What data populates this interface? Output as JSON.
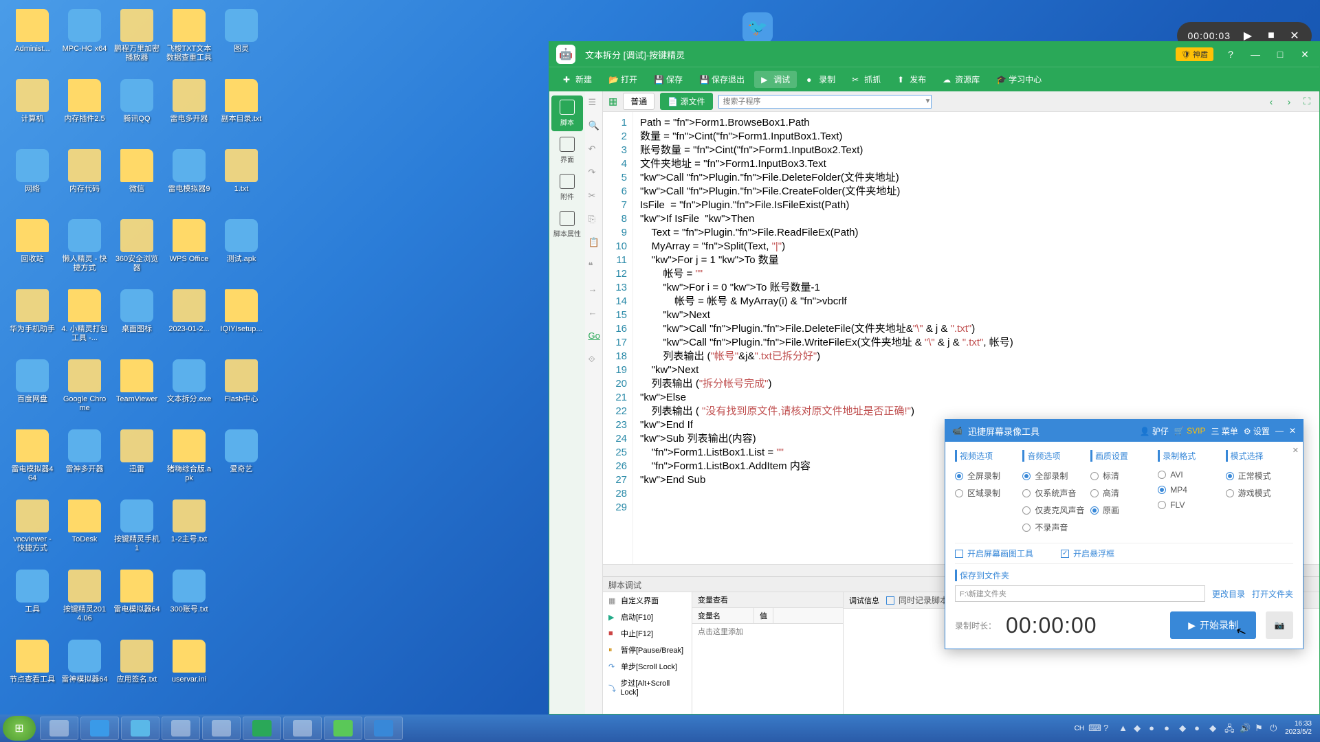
{
  "desktop": {
    "icons": [
      "Administ...",
      "MPC-HC x64",
      "鹏程万里加密播放器",
      "飞梭TXT文本数据查重工具",
      "图灵",
      "计算机",
      "内存插件2.5",
      "腾讯QQ",
      "雷电多开器",
      "副本目录.txt",
      "网络",
      "内存代码",
      "微信",
      "雷电模拟器9",
      "1.txt",
      "回收站",
      "懒人精灵 - 快捷方式",
      "360安全浏览器",
      "WPS Office",
      "测试.apk",
      "华为手机助手",
      "4. 小精灵打包工具 -...",
      "桌面图标",
      "2023-01-2...",
      "IQIYIsetup...",
      "百度网盘",
      "Google Chrome",
      "TeamViewer",
      "文本拆分.exe",
      "Flash中心",
      "雷电模拟器4 64",
      "雷神多开器",
      "迅雷",
      "猪嗨综合版.apk",
      "爱奇艺",
      "vncviewer - 快捷方式",
      "ToDesk",
      "按键精灵手机1",
      "1-2主号.txt",
      "",
      "工具",
      "按键精灵2014.06",
      "雷电模拟器64",
      "300账号.txt",
      "",
      "节点查看工具",
      "雷神模拟器64",
      "应用签名.txt",
      "uservar.ini",
      ""
    ]
  },
  "ide": {
    "title": "文本拆分  [调试]-按键精灵",
    "shield": "🛡 神盾",
    "toolbar": [
      "新建",
      "打开",
      "保存",
      "保存退出",
      "调试",
      "录制",
      "抓抓",
      "发布",
      "资源库",
      "学习中心"
    ],
    "sidebar": [
      "脚本",
      "界面",
      "附件",
      "脚本属性"
    ],
    "tabs": {
      "normal": "普通",
      "source": "源文件"
    },
    "search_placeholder": "搜索子程序",
    "code": [
      "Path = Form1.BrowseBox1.Path",
      "数量 = Cint(Form1.InputBox1.Text)",
      "账号数量 = Cint(Form1.InputBox2.Text)",
      "文件夹地址 = Form1.InputBox3.Text",
      "Call Plugin.File.DeleteFolder(文件夹地址)",
      "Call Plugin.File.CreateFolder(文件夹地址)",
      "IsFile  = Plugin.File.IsFileExist(Path)",
      "If IsFile  Then",
      "    Text = Plugin.File.ReadFileEx(Path)",
      "    MyArray = Split(Text, \"|\")",
      "    For j = 1 To 数量",
      "        帐号 = \"\"",
      "        For i = 0 To 账号数量-1",
      "            帐号 = 帐号 & MyArray(i) & vbcrlf",
      "        Next",
      "        Call Plugin.File.DeleteFile(文件夹地址&\"\\\" & j & \".txt\")",
      "        Call Plugin.File.WriteFileEx(文件夹地址 & \"\\\" & j & \".txt\", 帐号)",
      "        列表输出 (\"帐号\"&j&\".txt已拆分好\")",
      "    Next",
      "    列表输出 (\"拆分帐号完成\")",
      "Else",
      "    列表输出 ( \"没有找到原文件,请核对原文件地址是否正确!\")",
      "End If",
      "Sub 列表输出(内容)",
      "    Form1.ListBox1.List = \"\"",
      "    Form1.ListBox1.AddItem 内容",
      "End Sub",
      "",
      ""
    ],
    "debug": {
      "title": "脚本调试",
      "left": [
        "自定义界面",
        "启动[F10]",
        "中止[F12]",
        "暂停[Pause/Break]",
        "单步[Scroll Lock]",
        "步过[Alt+Scroll Lock]"
      ],
      "var_header": "变量查看",
      "var_cols": [
        "变量名",
        "值"
      ],
      "var_hint": "点击这里添加",
      "info_header": "调试信息",
      "info_check": "同时记录脚本的执行次序"
    }
  },
  "rec_controls": {
    "time": "00:00:03"
  },
  "recorder": {
    "title": "迅捷屏幕录像工具",
    "user": "驴仔",
    "svip": "SVIP",
    "menu": "三 菜单",
    "settings": "⚙ 设置",
    "cols": {
      "video": {
        "h": "视频选项",
        "opts": [
          "全屏录制",
          "区域录制"
        ],
        "checked": 0
      },
      "audio": {
        "h": "音频选项",
        "opts": [
          "全部录制",
          "仅系统声音",
          "仅麦克风声音",
          "不录声音"
        ],
        "checked": 0
      },
      "quality": {
        "h": "画质设置",
        "opts": [
          "标清",
          "高清",
          "原画"
        ],
        "checked": 2
      },
      "format": {
        "h": "录制格式",
        "opts": [
          "AVI",
          "MP4",
          "FLV"
        ],
        "checked": 1
      },
      "mode": {
        "h": "模式选择",
        "opts": [
          "正常模式",
          "游戏模式"
        ],
        "checked": 0
      }
    },
    "checks": {
      "draw": "开启屏幕画图工具",
      "float": "开启悬浮框",
      "float_checked": true
    },
    "save": {
      "h": "保存到文件夹",
      "path": "F:\\新建文件夹",
      "change": "更改目录",
      "open": "打开文件夹"
    },
    "footer": {
      "label": "录制时长：",
      "time": "00:00:00",
      "start": "开始录制"
    }
  },
  "taskbar": {
    "lang": "CH",
    "time": "16:33",
    "date": "2023/5/2"
  }
}
